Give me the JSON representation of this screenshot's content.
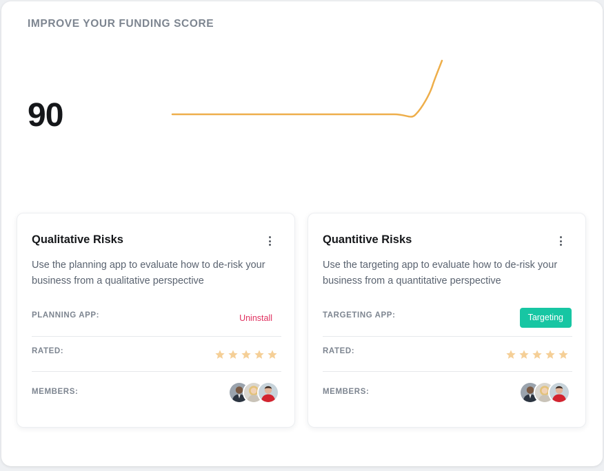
{
  "panel": {
    "title": "IMPROVE YOUR FUNDING SCORE",
    "score": "90",
    "sparkline_color": "#eeae4a"
  },
  "cards": [
    {
      "title": "Qualitative Risks",
      "description": "Use the planning app to evaluate how to de-risk your business from a qualitative perspective",
      "app_label": "PLANNING APP:",
      "app_action": "Uninstall",
      "rated_label": "RATED:",
      "rating": 5,
      "members_label": "MEMBERS:",
      "member_avatars": [
        "avatar-man-dark-suit",
        "avatar-woman-blonde",
        "avatar-man-red-shirt"
      ]
    },
    {
      "title": "Quantitive Risks",
      "description": "Use the targeting app to evaluate how to de-risk your business from a quantitative perspective",
      "app_label": "TARGETING APP:",
      "app_action": "Targeting",
      "rated_label": "RATED:",
      "rating": 5,
      "members_label": "MEMBERS:",
      "member_avatars": [
        "avatar-man-dark-suit",
        "avatar-woman-blonde",
        "avatar-man-red-shirt"
      ]
    }
  ],
  "colors": {
    "accent_danger": "#e0305f",
    "accent_success": "#17c6a3",
    "star": "#f5cf97"
  }
}
